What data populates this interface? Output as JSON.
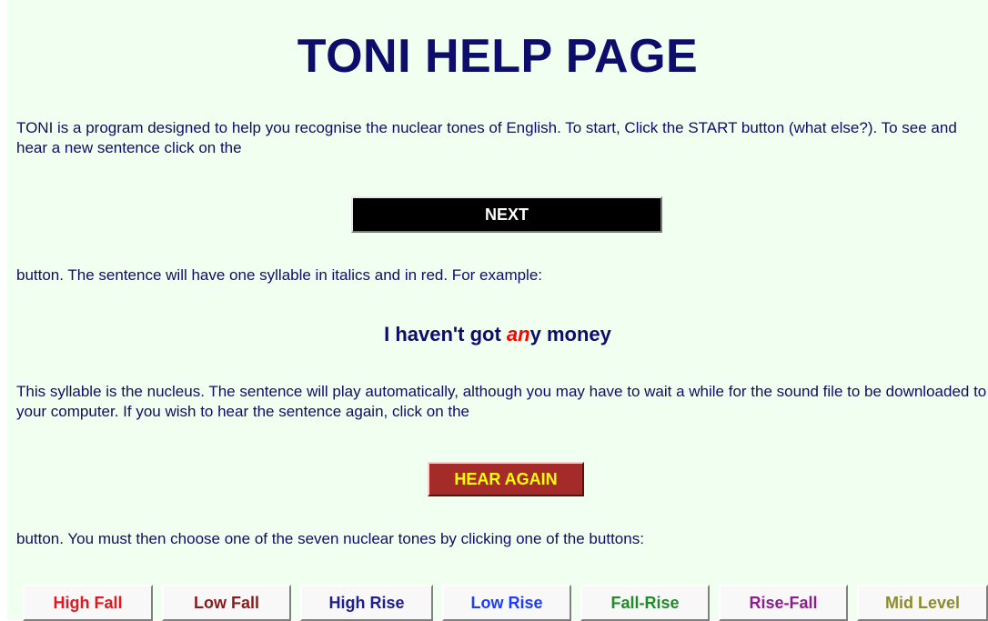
{
  "header": {
    "title": "TONI HELP PAGE"
  },
  "paragraphs": {
    "intro": "TONI is a program designed to help you recognise the nuclear tones of English. To start, Click the START button (what else?). To see and hear a new sentence click on the",
    "after_next": "button. The sentence will have one syllable in italics and in red. For example:",
    "nucleus_info": "This syllable is the nucleus. The sentence will play automatically, although you may have to wait a while for the sound file to be downloaded to your computer. If you wish to hear the sentence again, click on the",
    "choose": "button. You must then choose one of the seven nuclear tones by clicking one of the buttons:"
  },
  "buttons": {
    "next_label": "NEXT",
    "hear_again_label": "HEAR AGAIN"
  },
  "example": {
    "before": "I haven't got ",
    "nucleus": "an",
    "after": "y money",
    "nucleus_color": "#ff0000"
  },
  "tones": [
    {
      "label": "High Fall",
      "color": "#e8141e"
    },
    {
      "label": "Low Fall",
      "color": "#8b1a1a"
    },
    {
      "label": "High Rise",
      "color": "#1e1e8c"
    },
    {
      "label": "Low Rise",
      "color": "#1e3cff"
    },
    {
      "label": "Fall-Rise",
      "color": "#1e8c2a"
    },
    {
      "label": "Rise-Fall",
      "color": "#8c1e8c"
    },
    {
      "label": "Mid Level",
      "color": "#8c8c28"
    }
  ],
  "colors": {
    "background": "#f0fff0",
    "text": "#0d0d6b",
    "next_bg": "#000000",
    "hear_again_bg": "#a52a2a",
    "hear_again_text": "#ffff00"
  }
}
